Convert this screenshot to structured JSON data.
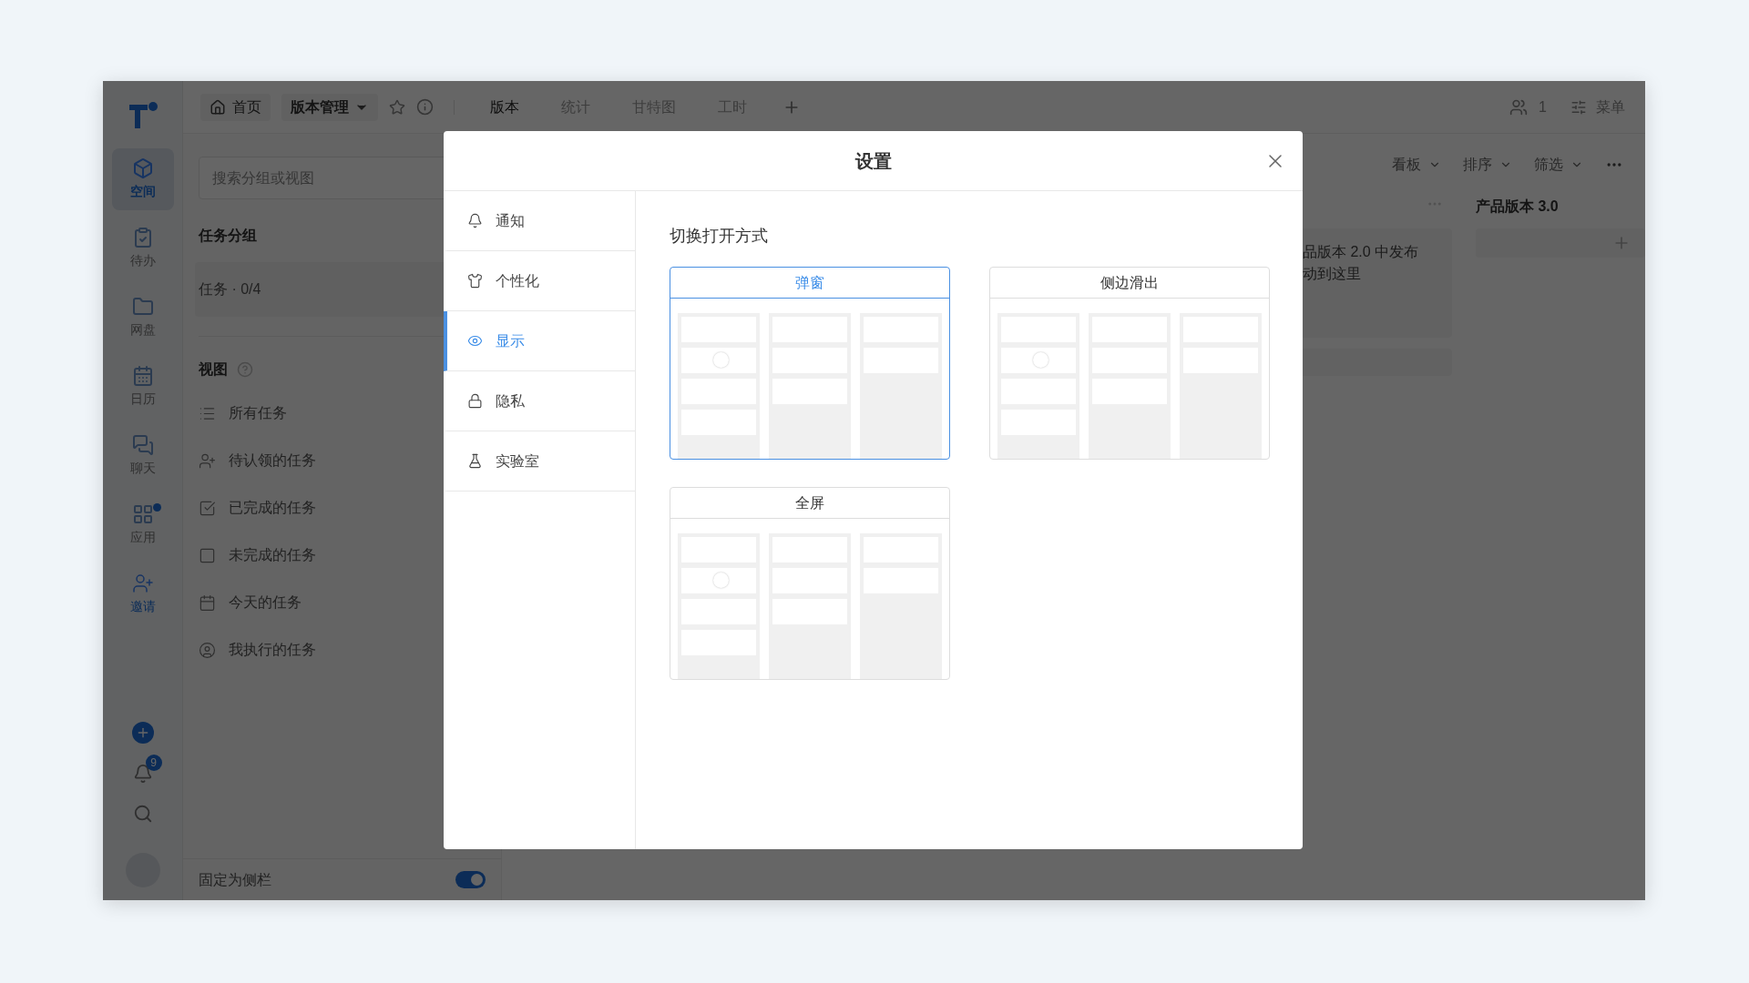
{
  "nav_rail": {
    "items": [
      {
        "label": "空间",
        "selected": true,
        "kind": "nav"
      },
      {
        "label": "待办",
        "selected": false,
        "kind": "nav"
      },
      {
        "label": "网盘",
        "selected": false,
        "kind": "nav"
      },
      {
        "label": "日历",
        "selected": false,
        "kind": "nav"
      },
      {
        "label": "聊天",
        "selected": false,
        "kind": "nav"
      },
      {
        "label": "应用",
        "selected": false,
        "kind": "nav",
        "dot": true
      },
      {
        "label": "邀请",
        "selected": false,
        "kind": "invite"
      }
    ],
    "notification_badge": "9"
  },
  "top_bar": {
    "home": "首页",
    "project": "版本管理",
    "tabs": [
      {
        "label": "版本",
        "selected": true
      },
      {
        "label": "统计",
        "selected": false
      },
      {
        "label": "甘特图",
        "selected": false
      },
      {
        "label": "工时",
        "selected": false
      }
    ],
    "member_count": "1",
    "menu": "菜单"
  },
  "side_panel": {
    "search": {
      "placeholder": "搜索分组或视图"
    },
    "groups_title": "任务分组",
    "group": "任务 · 0/4",
    "views_title": "视图",
    "views": [
      "所有任务",
      "待认领的任务",
      "已完成的任务",
      "未完成的任务",
      "今天的任务",
      "我执行的任务"
    ],
    "pin": {
      "label": "固定为侧栏",
      "on": true
    }
  },
  "board": {
    "toolbar": [
      "看板",
      "排序",
      "筛选"
    ],
    "card_lines": [
      "品版本 2.0 中发布",
      "动到这里"
    ],
    "column_title": "产品版本 3.0"
  },
  "modal": {
    "title": "设置",
    "nav": [
      {
        "label": "通知",
        "selected": false
      },
      {
        "label": "个性化",
        "selected": false
      },
      {
        "label": "显示",
        "selected": true
      },
      {
        "label": "隐私",
        "selected": false
      },
      {
        "label": "实验室",
        "selected": false
      }
    ],
    "section_title": "切换打开方式",
    "options": [
      {
        "label": "弹窗",
        "selected": true
      },
      {
        "label": "侧边滑出",
        "selected": false
      },
      {
        "label": "全屏",
        "selected": false
      }
    ]
  }
}
